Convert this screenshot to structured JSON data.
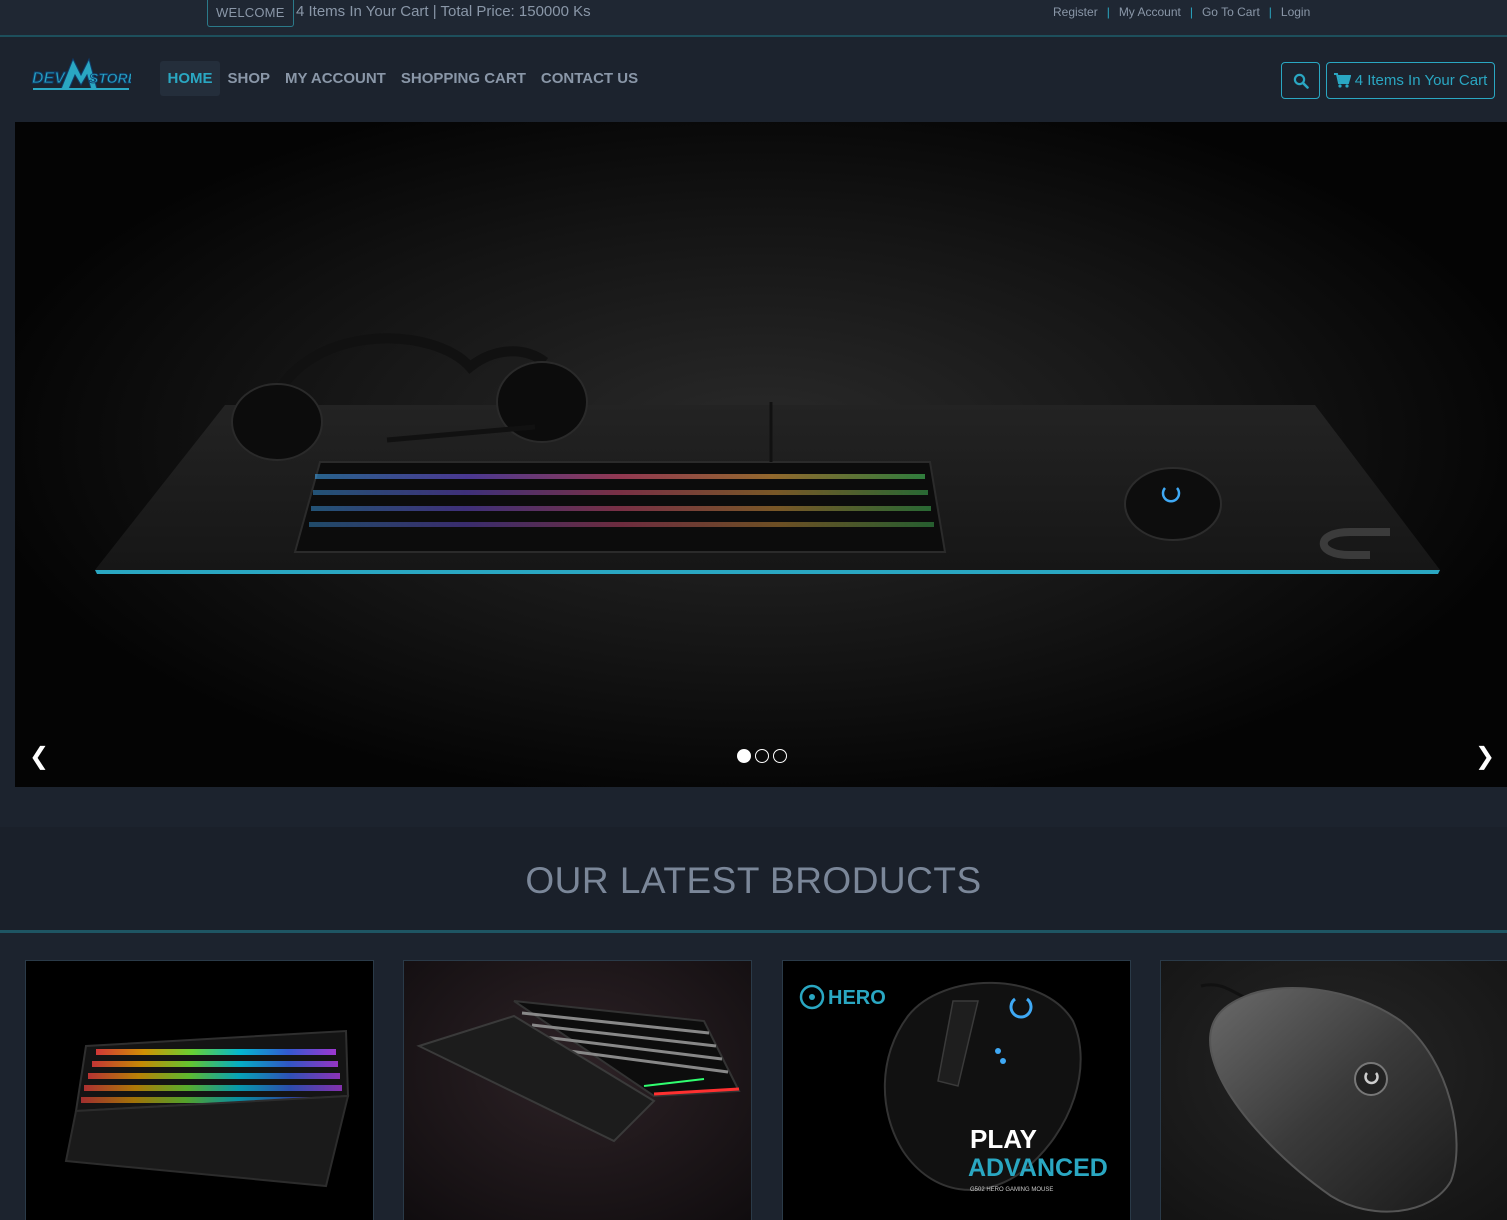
{
  "topbar": {
    "welcome": "WELCOME",
    "cart_summary": "4 Items In Your Cart | Total Price: 150000 Ks",
    "links": [
      "Register",
      "My Account",
      "Go To Cart",
      "Login"
    ]
  },
  "header": {
    "logo_text": "DEV STORE",
    "nav": [
      "HOME",
      "SHOP",
      "MY ACCOUNT",
      "SHOPPING CART",
      "CONTACT US"
    ],
    "active_nav": "HOME",
    "search_icon": "search-icon",
    "cart_button": "4 Items In Your Cart",
    "cart_icon": "shopping-cart-icon"
  },
  "hero": {
    "prev_arrow": "❮",
    "next_arrow": "❯",
    "slide_count": 3,
    "active_slide": 1
  },
  "latest": {
    "title": "OUR LATEST BRODUCTS",
    "products": [
      {
        "image": "rgb-gaming-keyboard"
      },
      {
        "image": "mechanical-keyboard-wrist-rest"
      },
      {
        "image": "hero-gaming-mouse",
        "badge": "HERO",
        "caption_line1": "PLAY",
        "caption_line2": "ADVANCED",
        "caption_small": "G502 HERO GAMING MOUSE"
      },
      {
        "image": "gaming-mouse-grey"
      }
    ]
  },
  "colors": {
    "accent": "#2aa7c2",
    "background": "#1c232e",
    "text_muted": "#8a97a8"
  }
}
